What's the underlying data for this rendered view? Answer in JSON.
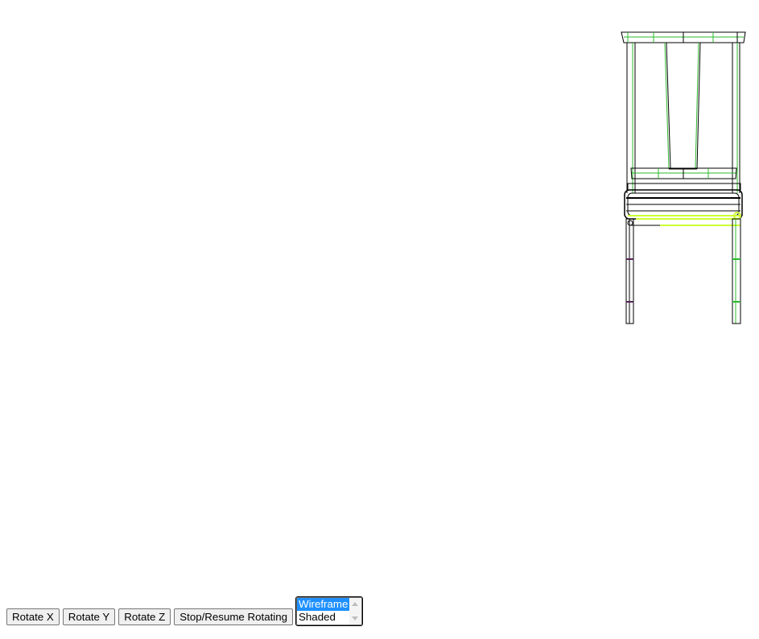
{
  "toolbar": {
    "rotate_x_label": "Rotate X",
    "rotate_y_label": "Rotate Y",
    "rotate_z_label": "Rotate Z",
    "stop_resume_label": "Stop/Resume Rotating"
  },
  "render_mode": {
    "options": [
      "Wireframe",
      "Shaded"
    ],
    "selected": "Wireframe"
  },
  "viewport": {
    "model": "chair",
    "mode": "wireframe",
    "colors": {
      "edge_dark": "#000000",
      "edge_green": "#22c322",
      "edge_lime": "#ccff33",
      "edge_purple": "#552255"
    }
  }
}
